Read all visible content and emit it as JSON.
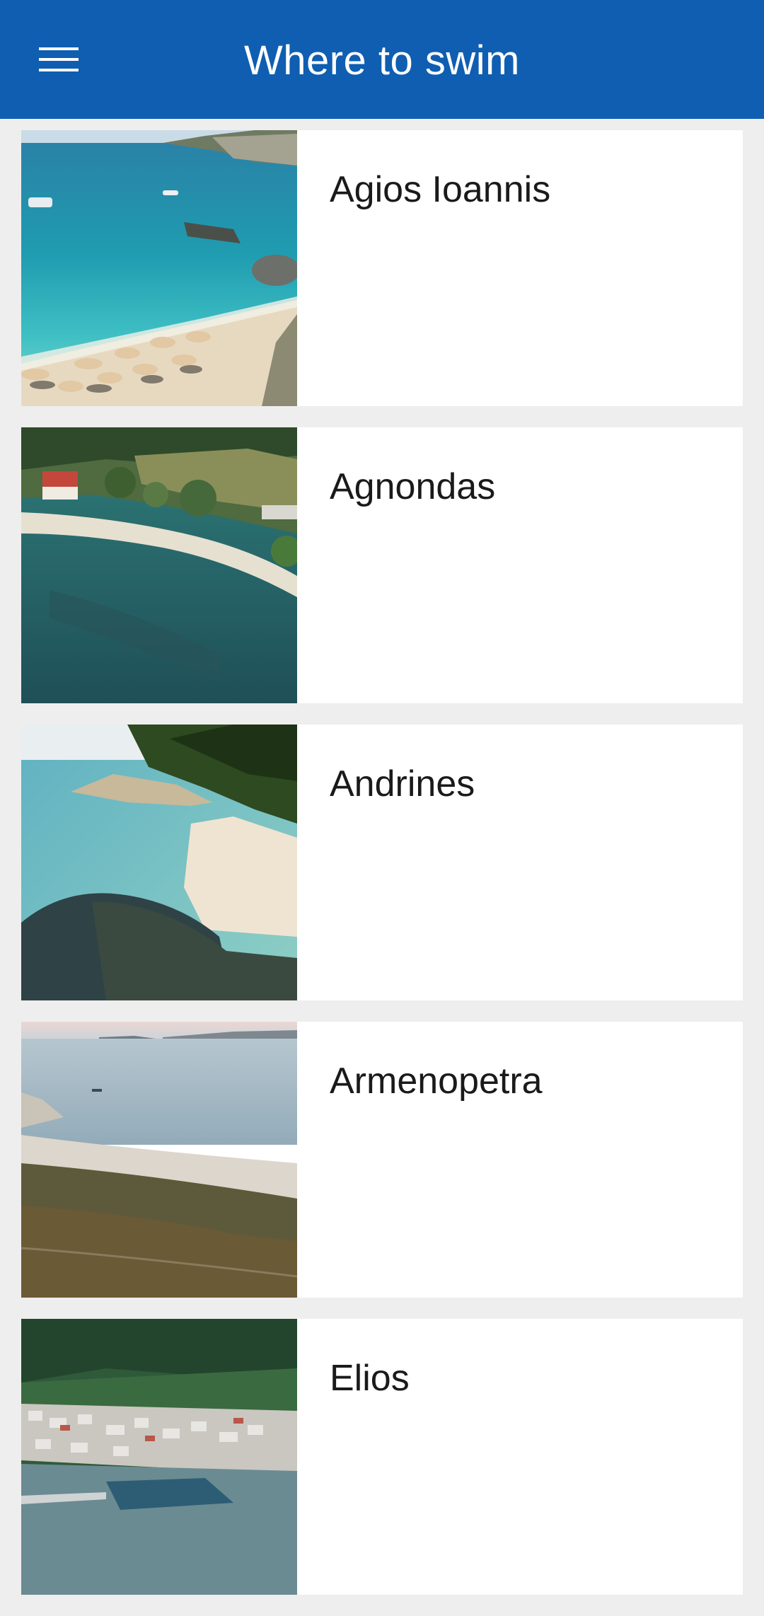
{
  "app_bar": {
    "title": "Where to swim",
    "menu_icon": "hamburger-menu-icon",
    "background": "#0f5eb1"
  },
  "beaches": [
    {
      "name": "Agios Ioannis",
      "image": "beach-photo"
    },
    {
      "name": "Agnondas",
      "image": "beach-photo"
    },
    {
      "name": "Andrines",
      "image": "beach-photo"
    },
    {
      "name": "Armenopetra",
      "image": "beach-photo"
    },
    {
      "name": "Elios",
      "image": "beach-photo"
    }
  ]
}
